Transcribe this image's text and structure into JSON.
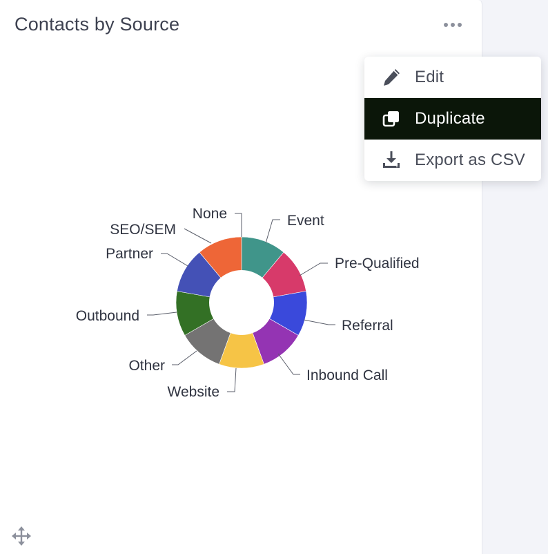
{
  "panel": {
    "title": "Contacts by Source",
    "more_icon": "more-horizontal-icon",
    "move_icon": "move-arrows-icon"
  },
  "menu": {
    "items": [
      {
        "label": "Edit",
        "icon": "pencil-icon",
        "active": false
      },
      {
        "label": "Duplicate",
        "icon": "duplicate-icon",
        "active": true
      },
      {
        "label": "Export as CSV",
        "icon": "download-icon",
        "active": false
      }
    ],
    "active_color": "#0b1609"
  },
  "chart_data": {
    "type": "pie",
    "donut": true,
    "categories": [
      "Event",
      "Pre-Qualified",
      "Referral",
      "Inbound Call",
      "Website",
      "Other",
      "Outbound",
      "Partner",
      "SEO/SEM",
      "None"
    ],
    "values": [
      10,
      10,
      10,
      10,
      10,
      10,
      10,
      10,
      10,
      10
    ],
    "colors": [
      "#40958a",
      "#d73a6a",
      "#3a49db",
      "#9434b3",
      "#f6c446",
      "#747373",
      "#337025",
      "#4451b6",
      "#ee6637",
      "#ee6637"
    ],
    "legend": "none"
  }
}
